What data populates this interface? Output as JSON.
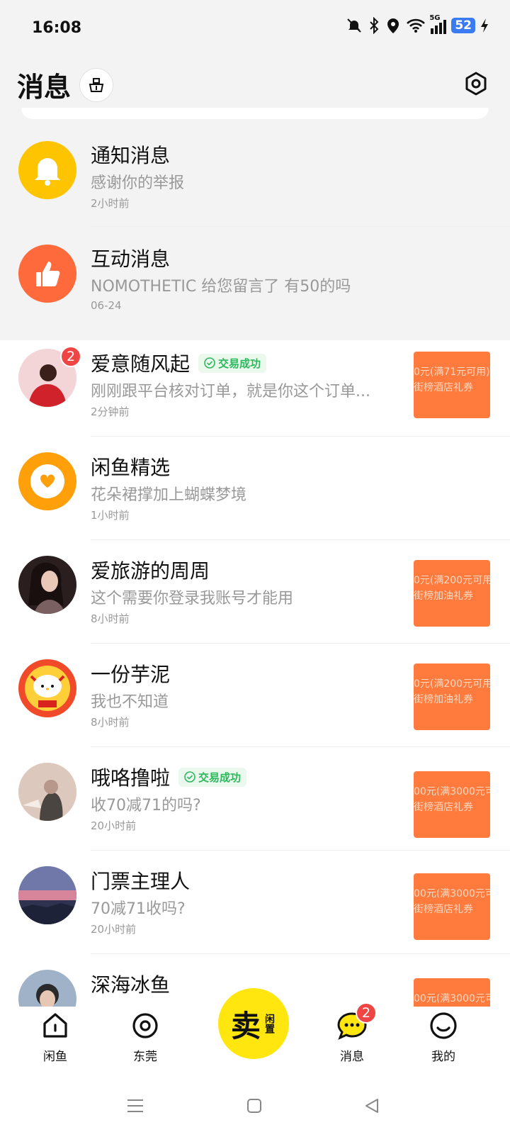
{
  "status": {
    "time": "16:08",
    "network": "5G",
    "battery": "52"
  },
  "header": {
    "title": "消息"
  },
  "system_rows": [
    {
      "name": "通知消息",
      "msg": "感谢你的举报",
      "time": "2小时前"
    },
    {
      "name": "互动消息",
      "msg": "NOMOTHETIC 给您留言了 有50的吗",
      "time": "06-24"
    }
  ],
  "conversations": [
    {
      "name": "爱意随风起",
      "tag": "交易成功",
      "msg": "刚刚跟平台核对订单，就是你这个订单...",
      "time": "2分钟前",
      "badge": "2",
      "thumb": [
        "0元(满71元可用)",
        "街榜酒店礼券"
      ]
    },
    {
      "name": "闲鱼精选",
      "msg": "花朵裙撑加上蝴蝶梦境",
      "time": "1小时前"
    },
    {
      "name": "爱旅游的周周",
      "msg": "这个需要你登录我账号才能用",
      "time": "8小时前",
      "thumb": [
        "0元(满200元可用",
        "街榜加油礼券"
      ]
    },
    {
      "name": "一份芋泥",
      "msg": "我也不知道",
      "time": "8小时前",
      "thumb": [
        "0元(满200元可用",
        "街榜加油礼券"
      ]
    },
    {
      "name": "哦咯撸啦",
      "tag": "交易成功",
      "msg": "收70减71的吗?",
      "time": "20小时前",
      "thumb": [
        "00元(满3000元可",
        "街榜酒店礼券"
      ]
    },
    {
      "name": "门票主理人",
      "msg": "70减71收吗?",
      "time": "20小时前",
      "thumb": [
        "00元(满3000元可",
        "街榜酒店礼券"
      ]
    },
    {
      "name": "深海冰鱼",
      "thumb": [
        "00元(满3000元可"
      ]
    }
  ],
  "tabbar": {
    "home": "闲鱼",
    "city": "东莞",
    "sell_big": "卖",
    "sell_small": "闲置",
    "messages": "消息",
    "messages_badge": "2",
    "mine": "我的"
  },
  "colors": {
    "brand_yellow": "#ffe60f",
    "badge_red": "#f04545",
    "success_green": "#2eb85c",
    "thumb_orange": "#ff7a3d"
  }
}
